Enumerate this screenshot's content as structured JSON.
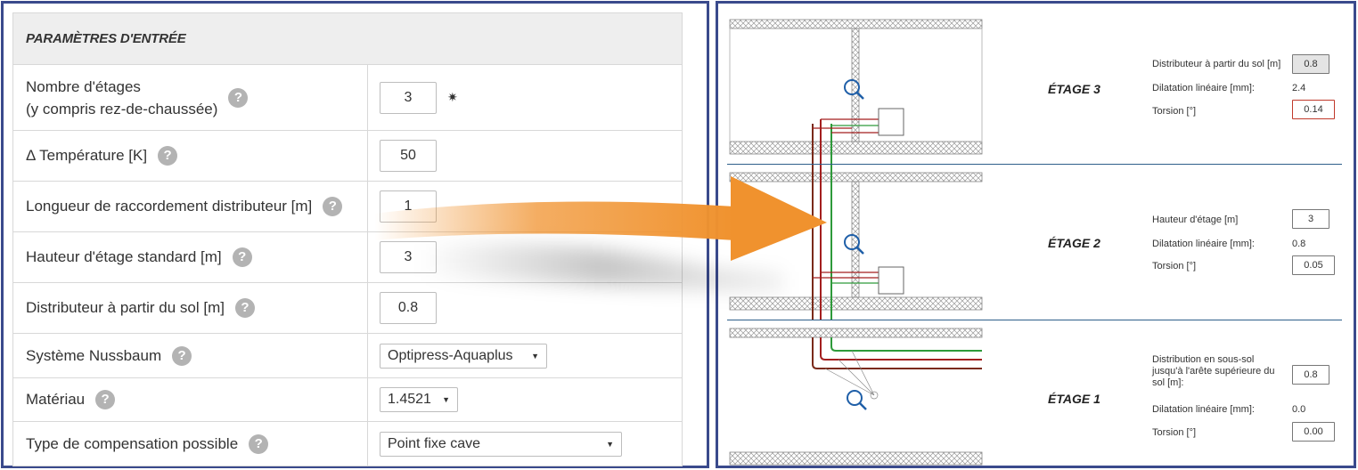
{
  "input_panel": {
    "header": "PARAMÈTRES D'ENTRÉE",
    "rows": [
      {
        "label_line1": "Nombre d'étages",
        "label_line2": "(y compris rez-de-chaussée)",
        "value": "3"
      },
      {
        "label": "Δ Température [K]",
        "value": "50"
      },
      {
        "label": "Longueur de raccordement distributeur [m]",
        "value": "1"
      },
      {
        "label": "Hauteur d'étage standard [m]",
        "value": "3"
      },
      {
        "label": "Distributeur à partir du sol [m]",
        "value": "0.8"
      },
      {
        "label": "Système Nussbaum",
        "value": "Optipress-Aquaplus"
      },
      {
        "label": "Matériau",
        "value": "1.4521"
      },
      {
        "label": "Type de compensation possible",
        "value": "Point fixe cave"
      }
    ],
    "help_glyph": "?",
    "required_glyph": "✷"
  },
  "floors": [
    {
      "title": "ÉTAGE 3",
      "fields": [
        {
          "label": "Distributeur à partir du sol [m]",
          "value": "0.8"
        },
        {
          "label": "Dilatation linéaire [mm]:",
          "value": "2.4"
        },
        {
          "label": "Torsion [°]",
          "value": "0.14"
        }
      ]
    },
    {
      "title": "ÉTAGE 2",
      "fields": [
        {
          "label": "Hauteur d'étage [m]",
          "value": "3"
        },
        {
          "label": "Dilatation linéaire [mm]:",
          "value": "0.8"
        },
        {
          "label": "Torsion [°]",
          "value": "0.05"
        }
      ]
    },
    {
      "title": "ÉTAGE 1",
      "fields": [
        {
          "label_line1": "Distribution en sous-sol",
          "label_line2": "jusqu'à l'arête supérieure du",
          "label_line3": "sol [m]:",
          "value": "0.8"
        },
        {
          "label": "Dilatation linéaire [mm]:",
          "value": "0.0"
        },
        {
          "label": "Torsion [°]",
          "value": "0.00"
        }
      ]
    }
  ],
  "icons": {
    "zoom": "magnifier-icon",
    "arrow": "orange-arrow"
  },
  "colors": {
    "frame": "#3a4a8c",
    "arrow": "#f0922e",
    "pipe_red": "#a31f1f",
    "pipe_green": "#2e9a3a",
    "magnifier": "#1f5fa8"
  }
}
